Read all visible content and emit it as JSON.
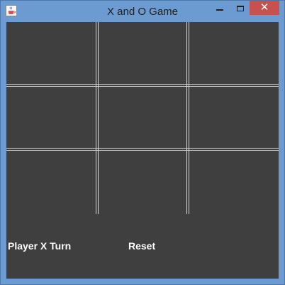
{
  "window": {
    "title": "X and O Game",
    "close_glyph": "✕"
  },
  "footer": {
    "status": "Player X Turn",
    "reset_label": "Reset"
  },
  "board": {
    "cells": [
      "",
      "",
      "",
      "",
      "",
      "",
      "",
      "",
      ""
    ]
  },
  "icons": {
    "app": "java-cup-icon",
    "minimize": "minimize-icon",
    "maximize": "maximize-icon",
    "close": "close-icon"
  },
  "colors": {
    "frame": "#6b9bd0",
    "panel": "#3f3f3f",
    "grid_line": "#d8d8d8",
    "close_button": "#c7514d",
    "text": "#ffffff"
  }
}
